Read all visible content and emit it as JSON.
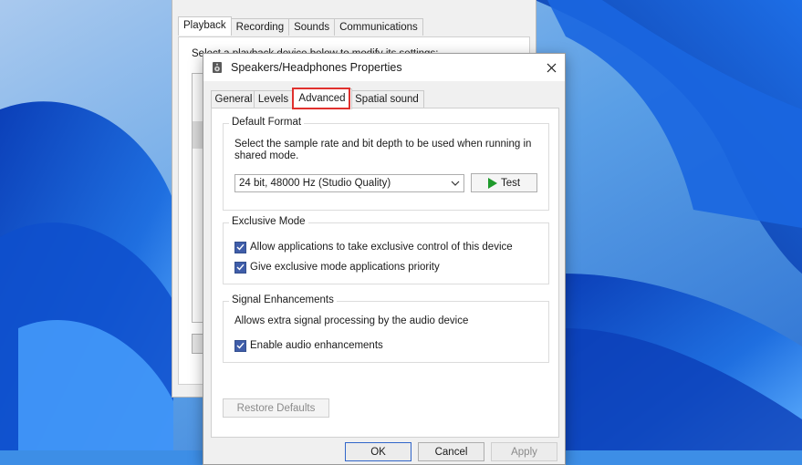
{
  "back_dialog": {
    "tabs": [
      "Playback",
      "Recording",
      "Sounds",
      "Communications"
    ],
    "instruction": "Select a playback device below to modify its settings:"
  },
  "dialog": {
    "title": "Speakers/Headphones Properties",
    "tabs": [
      "General",
      "Levels",
      "Advanced",
      "Spatial sound"
    ],
    "active_tab": "Advanced",
    "default_format": {
      "title": "Default Format",
      "description": "Select the sample rate and bit depth to be used when running in shared mode.",
      "selected": "24 bit, 48000 Hz (Studio Quality)",
      "test_label": "Test"
    },
    "exclusive_mode": {
      "title": "Exclusive Mode",
      "allow_exclusive": {
        "label": "Allow applications to take exclusive control of this device",
        "checked": true
      },
      "priority": {
        "label": "Give exclusive mode applications priority",
        "checked": true
      }
    },
    "signal_enhancements": {
      "title": "Signal Enhancements",
      "description": "Allows extra signal processing by the audio device",
      "enable": {
        "label": "Enable audio enhancements",
        "checked": true
      }
    },
    "restore_label": "Restore Defaults",
    "ok_label": "OK",
    "cancel_label": "Cancel",
    "apply_label": "Apply"
  },
  "colors": {
    "accent_highlight": "#e0312e",
    "checkbox": "#3f5da9",
    "play_icon": "#1f9a2c"
  }
}
